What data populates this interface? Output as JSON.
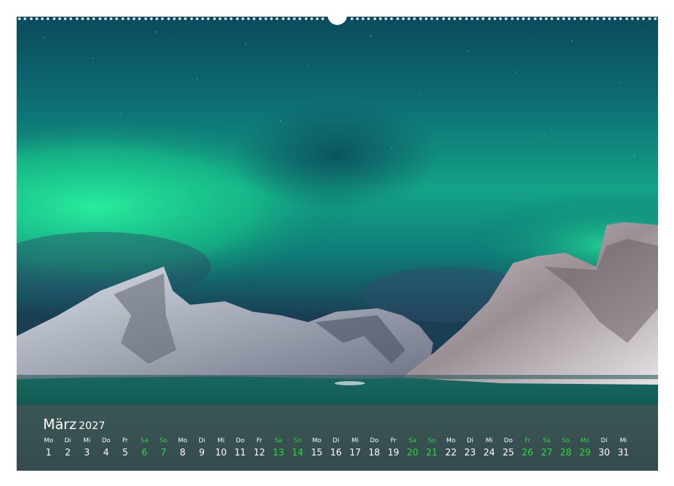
{
  "calendar": {
    "month": "März",
    "year": "2027",
    "days": [
      {
        "wd": "Mo",
        "n": "1",
        "weekend": false
      },
      {
        "wd": "Di",
        "n": "2",
        "weekend": false
      },
      {
        "wd": "Mi",
        "n": "3",
        "weekend": false
      },
      {
        "wd": "Do",
        "n": "4",
        "weekend": false
      },
      {
        "wd": "Fr",
        "n": "5",
        "weekend": false
      },
      {
        "wd": "Sa",
        "n": "6",
        "weekend": true
      },
      {
        "wd": "So",
        "n": "7",
        "weekend": true
      },
      {
        "wd": "Mo",
        "n": "8",
        "weekend": false
      },
      {
        "wd": "Di",
        "n": "9",
        "weekend": false
      },
      {
        "wd": "Mi",
        "n": "10",
        "weekend": false
      },
      {
        "wd": "Do",
        "n": "11",
        "weekend": false
      },
      {
        "wd": "Fr",
        "n": "12",
        "weekend": false
      },
      {
        "wd": "Sa",
        "n": "13",
        "weekend": true
      },
      {
        "wd": "So",
        "n": "14",
        "weekend": true
      },
      {
        "wd": "Mo",
        "n": "15",
        "weekend": false
      },
      {
        "wd": "Di",
        "n": "16",
        "weekend": false
      },
      {
        "wd": "Mi",
        "n": "17",
        "weekend": false
      },
      {
        "wd": "Do",
        "n": "18",
        "weekend": false
      },
      {
        "wd": "Fr",
        "n": "19",
        "weekend": false
      },
      {
        "wd": "Sa",
        "n": "20",
        "weekend": true
      },
      {
        "wd": "So",
        "n": "21",
        "weekend": true
      },
      {
        "wd": "Mo",
        "n": "22",
        "weekend": false
      },
      {
        "wd": "Di",
        "n": "23",
        "weekend": false
      },
      {
        "wd": "Mi",
        "n": "24",
        "weekend": false
      },
      {
        "wd": "Do",
        "n": "25",
        "weekend": false
      },
      {
        "wd": "Fr",
        "n": "26",
        "weekend": true
      },
      {
        "wd": "Sa",
        "n": "27",
        "weekend": true
      },
      {
        "wd": "So",
        "n": "28",
        "weekend": true
      },
      {
        "wd": "Mo",
        "n": "29",
        "weekend": true
      },
      {
        "wd": "Di",
        "n": "30",
        "weekend": false
      },
      {
        "wd": "Mi",
        "n": "31",
        "weekend": false
      }
    ]
  },
  "colors": {
    "weekday": "#ffffff",
    "weekend_holiday": "#2ad93a",
    "aurora": "#1de58a",
    "sky": "#0f5f6e"
  },
  "photo": {
    "subject_icon": "aurora-landscape-photo"
  }
}
